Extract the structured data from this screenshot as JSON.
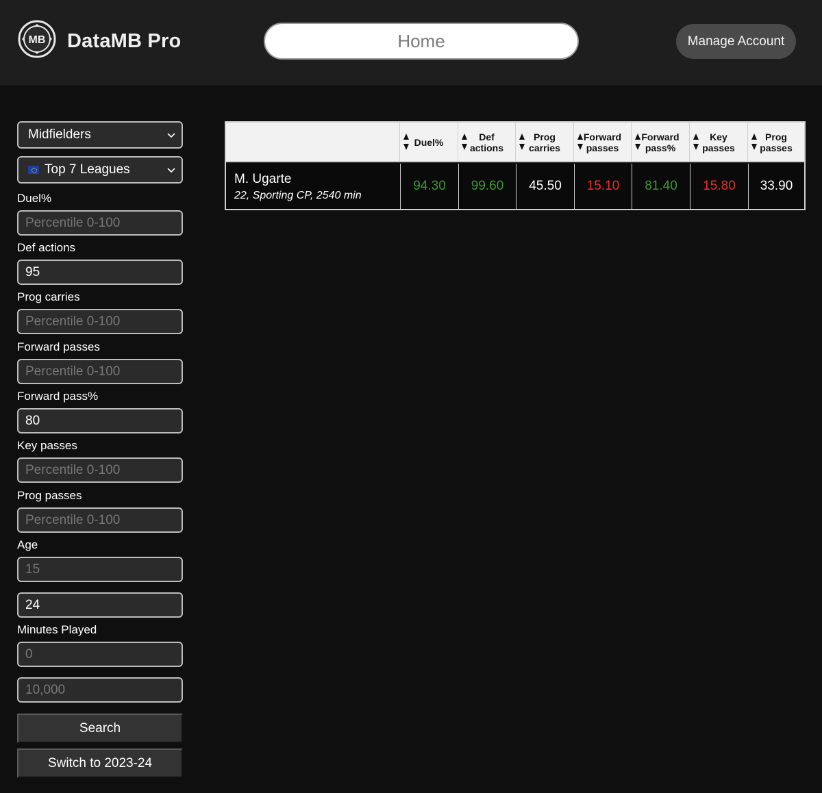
{
  "header": {
    "brand": "DataMB Pro",
    "logo_text": "MB",
    "home_label": "Home",
    "manage_label": "Manage Account"
  },
  "filters": {
    "position": "Midfielders",
    "league": "Top 7 Leagues",
    "fields": [
      {
        "label": "Duel%",
        "value": "",
        "placeholder": "Percentile 0-100"
      },
      {
        "label": "Def actions",
        "value": "95",
        "placeholder": "Percentile 0-100"
      },
      {
        "label": "Prog carries",
        "value": "",
        "placeholder": "Percentile 0-100"
      },
      {
        "label": "Forward passes",
        "value": "",
        "placeholder": "Percentile 0-100"
      },
      {
        "label": "Forward pass%",
        "value": "80",
        "placeholder": "Percentile 0-100"
      },
      {
        "label": "Key passes",
        "value": "",
        "placeholder": "Percentile 0-100"
      },
      {
        "label": "Prog passes",
        "value": "",
        "placeholder": "Percentile 0-100"
      }
    ],
    "age": {
      "label": "Age",
      "min_placeholder": "15",
      "max_value": "24"
    },
    "minutes": {
      "label": "Minutes Played",
      "min_placeholder": "0",
      "max_placeholder": "10,000"
    },
    "search_label": "Search",
    "switch_label": "Switch to 2023-24"
  },
  "table": {
    "columns": [
      {
        "line1": "Duel%",
        "line2": ""
      },
      {
        "line1": "Def",
        "line2": "actions"
      },
      {
        "line1": "Prog",
        "line2": "carries"
      },
      {
        "line1": "Forward",
        "line2": "passes"
      },
      {
        "line1": "Forward",
        "line2": "pass%"
      },
      {
        "line1": "Key",
        "line2": "passes"
      },
      {
        "line1": "Prog",
        "line2": "passes"
      }
    ],
    "rows": [
      {
        "name": "M. Ugarte",
        "info": "22, Sporting CP, 2540 min",
        "values": [
          "94.30",
          "99.60",
          "45.50",
          "15.10",
          "81.40",
          "15.80",
          "33.90"
        ],
        "colors": [
          "#3c9a2e",
          "#3c9a2e",
          "#ffffff",
          "#e8302a",
          "#3c9a2e",
          "#e8302a",
          "#ffffff"
        ]
      }
    ]
  }
}
